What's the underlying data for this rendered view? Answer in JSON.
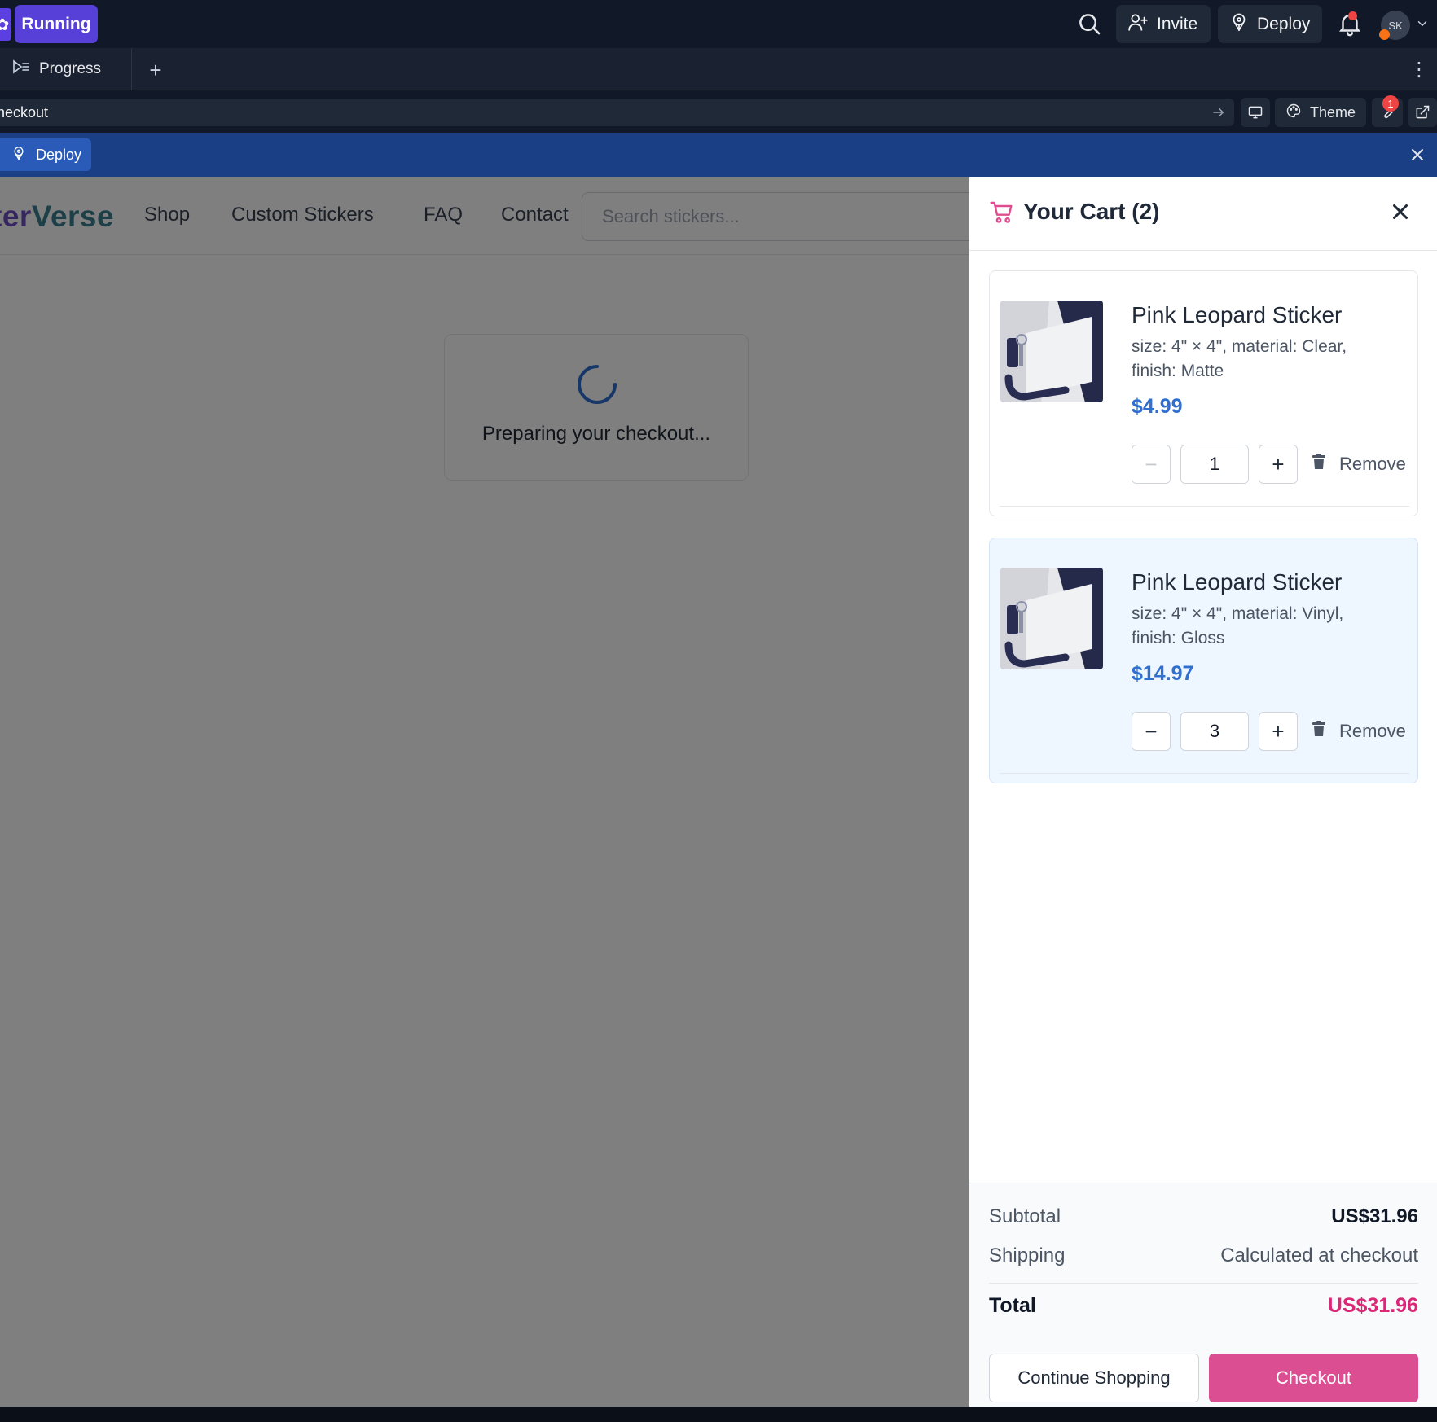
{
  "topbar": {
    "status_label": "Running",
    "invite_label": "Invite",
    "deploy_label": "Deploy",
    "avatar_initials": "SK"
  },
  "tabs": {
    "active_tab_label": "Progress"
  },
  "urlbar": {
    "url_text": "heckout",
    "theme_label": "Theme",
    "tools_badge_count": "1"
  },
  "deploy_banner": {
    "label": "Deploy"
  },
  "site": {
    "brand_visible": "ter",
    "brand_accent": "Verse",
    "nav": [
      "Shop",
      "Custom Stickers",
      "FAQ",
      "Contact"
    ],
    "search_placeholder": "Search stickers...",
    "loading_text": "Preparing your checkout..."
  },
  "cart": {
    "title": "Your Cart (2)",
    "items": [
      {
        "name": "Pink Leopard Sticker",
        "options": "size: 4\" × 4\", material: Clear, finish: Matte",
        "price": "$4.99",
        "quantity": "1",
        "remove_label": "Remove"
      },
      {
        "name": "Pink Leopard Sticker",
        "options": "size: 4\" × 4\", material: Vinyl, finish: Gloss",
        "price": "$14.97",
        "quantity": "3",
        "remove_label": "Remove"
      }
    ],
    "summary": {
      "subtotal_label": "Subtotal",
      "subtotal_value": "US$31.96",
      "shipping_label": "Shipping",
      "shipping_value": "Calculated at checkout",
      "total_label": "Total",
      "total_value": "US$31.96"
    },
    "continue_label": "Continue Shopping",
    "checkout_label": "Checkout"
  },
  "colors": {
    "running_pill": "#5640d8",
    "deploy_banner": "#1a3f85",
    "price_blue": "#2f6fd0",
    "checkout_pink": "#db4f92",
    "total_pink": "#db2777"
  },
  "icons": [
    "search-icon",
    "user-plus-icon",
    "deploy-icon",
    "bell-icon",
    "chevron-down-icon",
    "progress-icon",
    "plus-icon",
    "kebab-icon",
    "arrow-right-icon",
    "monitor-icon",
    "palette-icon",
    "wrench-icon",
    "external-link-icon",
    "close-icon",
    "cart-icon",
    "trash-icon",
    "spinner-icon"
  ]
}
